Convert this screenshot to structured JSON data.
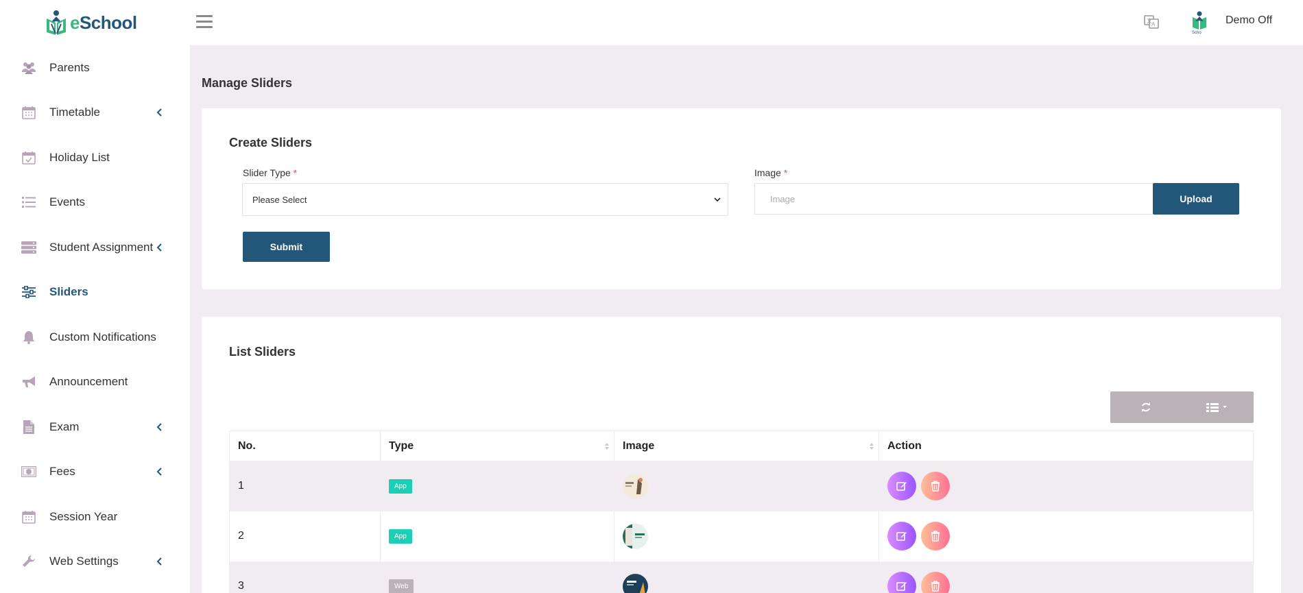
{
  "brand": {
    "name_prefix": "e",
    "name_rest": "School"
  },
  "topbar": {
    "user_name": "Demo Off",
    "menu_icon": "hamburger-icon",
    "language_icon": "translate-icon"
  },
  "sidebar": {
    "items": [
      {
        "label": "Parents",
        "icon": "users-icon",
        "has_submenu": false
      },
      {
        "label": "Timetable",
        "icon": "calendar-icon",
        "has_submenu": true
      },
      {
        "label": "Holiday List",
        "icon": "calendar-check-icon",
        "has_submenu": false
      },
      {
        "label": "Events",
        "icon": "list-icon",
        "has_submenu": false
      },
      {
        "label": "Student Assignment",
        "icon": "server-icon",
        "has_submenu": true
      },
      {
        "label": "Sliders",
        "icon": "sliders-icon",
        "has_submenu": false,
        "active": true
      },
      {
        "label": "Custom Notifications",
        "icon": "bell-icon",
        "has_submenu": false
      },
      {
        "label": "Announcement",
        "icon": "bullhorn-icon",
        "has_submenu": false
      },
      {
        "label": "Exam",
        "icon": "file-icon",
        "has_submenu": true
      },
      {
        "label": "Fees",
        "icon": "money-icon",
        "has_submenu": true
      },
      {
        "label": "Session Year",
        "icon": "calendar-icon",
        "has_submenu": false
      },
      {
        "label": "Web Settings",
        "icon": "wrench-icon",
        "has_submenu": true
      }
    ]
  },
  "page": {
    "title": "Manage Sliders"
  },
  "create": {
    "title": "Create Sliders",
    "slider_type_label": "Slider Type",
    "required_mark": "*",
    "slider_type_value": "Please Select",
    "image_label": "Image",
    "image_placeholder": "Image",
    "upload_label": "Upload",
    "submit_label": "Submit"
  },
  "list": {
    "title": "List Sliders",
    "columns": [
      "No.",
      "Type",
      "Image",
      "Action"
    ],
    "rows": [
      {
        "no": "1",
        "type": "App",
        "image": "thumb-1"
      },
      {
        "no": "2",
        "type": "App",
        "image": "thumb-2"
      },
      {
        "no": "3",
        "type": "Web",
        "image": "thumb-3"
      }
    ]
  },
  "colors": {
    "primary": "#22577a",
    "accent_green": "#3bb87e",
    "badge_app": "#1bcfb4",
    "badge_web": "#b9b3b8",
    "bg": "#f1ecf1"
  }
}
